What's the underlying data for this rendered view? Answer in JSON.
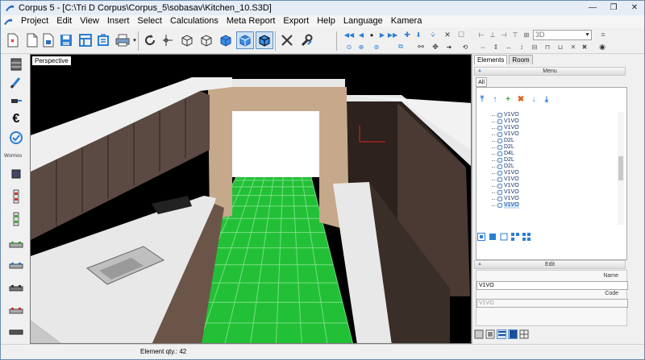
{
  "window": {
    "title": "Corpus 5 - [C:\\Tri D Corpus\\Corpus_5\\sobasav\\Kitchen_10.S3D]",
    "minimize": "—",
    "restore": "❐",
    "close": "✕"
  },
  "menubar": {
    "items": [
      "Project",
      "Edit",
      "View",
      "Insert",
      "Select",
      "Calculations",
      "Meta Report",
      "Export",
      "Help",
      "Language",
      "Kamera"
    ]
  },
  "toolbar": {
    "view_dropdown": "3D"
  },
  "leftbar": {
    "wormos_label": "Wormos"
  },
  "viewport": {
    "view_label": "Perspective",
    "colors": {
      "floor": "#22c036",
      "floor_grid": "#8fe59a",
      "wood": "#c6a88a",
      "dark_wood": "#4a3a33",
      "countertop": "#e8e8e8"
    }
  },
  "rightpanel": {
    "tabs": [
      "Elements",
      "Room"
    ],
    "menu_header": "Menu",
    "subtab": "All",
    "tree_items": [
      "V1VO",
      "V1VO",
      "V1VO",
      "V1VO",
      "D2L",
      "D2L",
      "D4L",
      "D2L",
      "D2L",
      "V1VO",
      "V1VO",
      "V1VO",
      "V1VO",
      "V1VO",
      "V1VO"
    ],
    "selected_index": 14,
    "edit_header": "Edit",
    "name_label": "Name",
    "name_value": "V1VO",
    "code_label": "Code",
    "code_value": "V1VO"
  },
  "status": {
    "element_qty": "Element qty.: 42"
  }
}
